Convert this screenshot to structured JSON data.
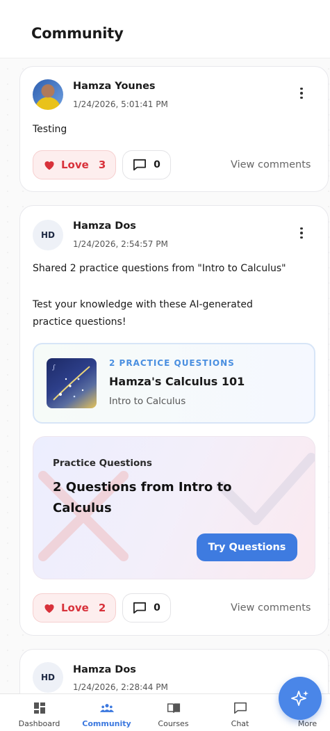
{
  "header": {
    "title": "Community"
  },
  "posts": [
    {
      "author": "Hamza Younes",
      "timestamp": "1/24/2026, 5:01:41 PM",
      "text": "Testing",
      "love_label": "Love",
      "love_count": "3",
      "comment_count": "0",
      "view_comments": "View comments"
    },
    {
      "avatar_initials": "HD",
      "author": "Hamza Dos",
      "timestamp": "1/24/2026, 2:54:57 PM",
      "text_line1": "Shared 2 practice questions from \"Intro to Calculus\"",
      "text_line2": "Test your knowledge with these AI-generated",
      "text_line3": "practice questions!",
      "shared": {
        "tag": "2 PRACTICE QUESTIONS",
        "title": "Hamza's Calculus 101",
        "subtitle": "Intro to Calculus"
      },
      "practice": {
        "label": "Practice Questions",
        "title": "2 Questions from Intro to Calculus",
        "button": "Try Questions"
      },
      "love_label": "Love",
      "love_count": "2",
      "comment_count": "0",
      "view_comments": "View comments"
    },
    {
      "avatar_initials": "HD",
      "author": "Hamza Dos",
      "timestamp": "1/24/2026, 2:28:44 PM"
    }
  ],
  "nav": [
    {
      "label": "Dashboard",
      "icon": "dashboard-icon"
    },
    {
      "label": "Community",
      "icon": "community-icon",
      "active": true
    },
    {
      "label": "Courses",
      "icon": "book-icon"
    },
    {
      "label": "Chat",
      "icon": "chat-icon"
    },
    {
      "label": "More",
      "icon": "more-icon"
    }
  ],
  "colors": {
    "accent": "#3e7be0",
    "love": "#d8323b",
    "love_bg": "#fdeeee"
  }
}
